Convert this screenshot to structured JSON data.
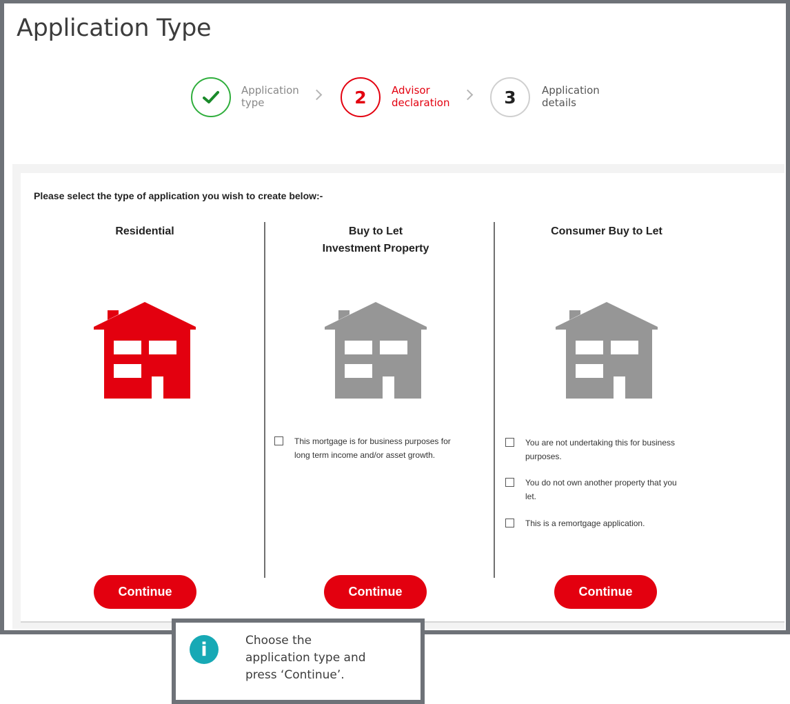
{
  "page": {
    "title": "Application Type"
  },
  "stepper": {
    "steps": [
      {
        "marker": "✔",
        "line1": "Application",
        "line2": "type",
        "state": "done"
      },
      {
        "marker": "2",
        "line1": "Advisor",
        "line2": "declaration",
        "state": "active"
      },
      {
        "marker": "3",
        "line1": "Application",
        "line2": "details",
        "state": "pending"
      }
    ],
    "chevron": "chevron-right-icon"
  },
  "panel": {
    "instruction": "Please select the type of application you wish to create below:-",
    "options": [
      {
        "title_line1": "Residential",
        "title_line2": "",
        "icon": "house-icon",
        "icon_color": "#e3000f",
        "checkboxes": [],
        "continue_label": "Continue"
      },
      {
        "title_line1": "Buy to Let",
        "title_line2": "Investment Property",
        "icon": "house-icon",
        "icon_color": "#969696",
        "checkboxes": [
          {
            "line1": "This mortgage is for business purposes for",
            "line2": "long term income and/or asset growth.",
            "checked": false
          }
        ],
        "continue_label": "Continue"
      },
      {
        "title_line1": "Consumer Buy to Let",
        "title_line2": "",
        "icon": "house-icon",
        "icon_color": "#969696",
        "checkboxes": [
          {
            "line1": "You are not undertaking this for business",
            "line2": "purposes.",
            "checked": false
          },
          {
            "line1": "You do not own another property that you",
            "line2": "let.",
            "checked": false
          },
          {
            "line1": "This is a remortgage application.",
            "line2": "",
            "checked": false
          }
        ],
        "continue_label": "Continue"
      }
    ]
  },
  "callout": {
    "icon": "info-icon",
    "icon_glyph": "i",
    "icon_color": "#17a9b5",
    "line1": "Choose the",
    "line2": "application type and",
    "line3": "press ‘Continue’."
  },
  "colors": {
    "accent": "#e3000f",
    "success": "#2fae3c",
    "frame": "#6e7278"
  }
}
